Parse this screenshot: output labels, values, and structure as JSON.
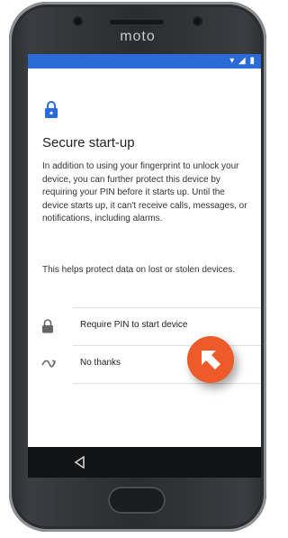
{
  "device": {
    "brand": "moto"
  },
  "status_bar": {
    "icons": [
      "wifi-icon",
      "signal-icon",
      "battery-icon"
    ],
    "color": "#2b6bd8"
  },
  "screen": {
    "title": "Secure start-up",
    "description": "In addition to using your fingerprint to unlock your device, you can further protect this device by requiring your PIN before it starts up. Until the device starts up, it can't receive calls, messages, or notifications, including alarms.",
    "description2": "This helps protect data on lost or stolen devices.",
    "options": [
      {
        "label": "Require PIN to start device",
        "icon": "lock-icon"
      },
      {
        "label": "No thanks",
        "icon": "swipe-icon"
      }
    ]
  },
  "colors": {
    "accent": "#2b6bd8",
    "cursor_badge": "#ef5a2a"
  }
}
